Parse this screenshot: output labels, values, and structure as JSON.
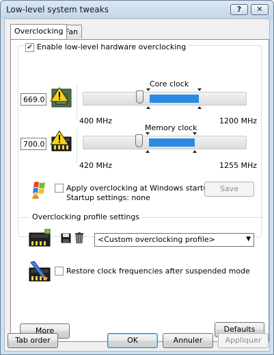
{
  "window": {
    "title": "Low-level system tweaks",
    "help_label": "?",
    "close_label": "✕"
  },
  "tabs": [
    {
      "label": "Overclocking",
      "active": true
    },
    {
      "label": "Fan",
      "active": false
    }
  ],
  "overclocking": {
    "enable_label": "Enable low-level hardware overclocking",
    "enable_checked": true,
    "core": {
      "title": "Core clock",
      "value": "669.0",
      "min_label": "400 MHz",
      "max_label": "1200 MHz",
      "min": 400,
      "max": 1200,
      "current": 669,
      "range_low": 669,
      "range_high": 1000
    },
    "memory": {
      "title": "Memory clock",
      "value": "700.0",
      "min_label": "420 MHz",
      "max_label": "1255 MHz",
      "min": 420,
      "max": 1255,
      "current": 700,
      "range_low": 700,
      "range_high": 1020
    },
    "startup": {
      "apply_label": "Apply overclocking at Windows startup",
      "apply_checked": false,
      "settings_text": "Startup settings: none",
      "save_label": "Save"
    },
    "profile": {
      "section_title": "Overclocking profile settings",
      "selected": "<Custom overclocking profile>"
    },
    "restore_label": "Restore clock frequencies after suspended mode",
    "restore_checked": false
  },
  "panel_buttons": {
    "more_label": "More",
    "defaults_label": "Defaults"
  },
  "footer": {
    "tab_order_label": "Tab order",
    "ok_label": "OK",
    "cancel_label": "Annuler",
    "apply_label": "Appliquer"
  },
  "colors": {
    "slider_fill": "#2a8ae6",
    "title_bar": "#cfe0ef"
  }
}
